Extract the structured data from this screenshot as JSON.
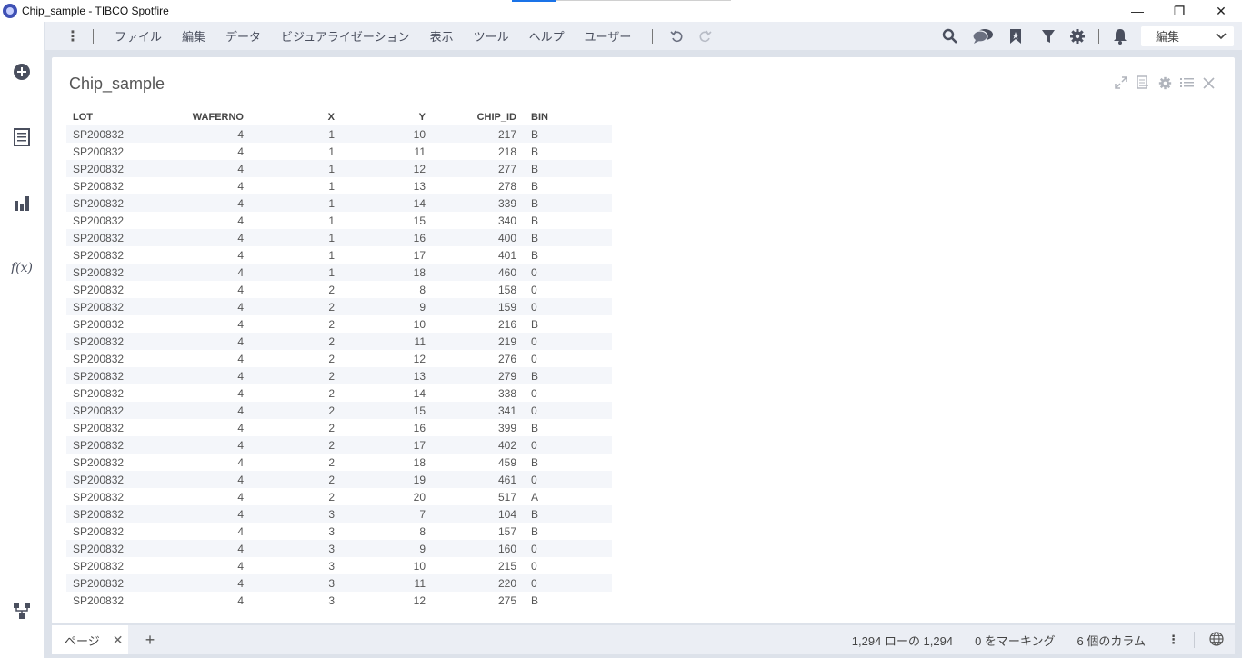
{
  "window": {
    "title": "Chip_sample - TIBCO Spotfire",
    "minimize": "—",
    "restore": "❐",
    "close": "✕"
  },
  "menu": {
    "items": [
      "ファイル",
      "編集",
      "データ",
      "ビジュアライゼーション",
      "表示",
      "ツール",
      "ヘルプ",
      "ユーザー"
    ],
    "mode": "編集"
  },
  "panel": {
    "title": "Chip_sample"
  },
  "table": {
    "columns": [
      "LOT",
      "WAFERNO",
      "X",
      "Y",
      "CHIP_ID",
      "BIN"
    ],
    "rows": [
      [
        "SP200832",
        "4",
        "1",
        "10",
        "217",
        "B"
      ],
      [
        "SP200832",
        "4",
        "1",
        "11",
        "218",
        "B"
      ],
      [
        "SP200832",
        "4",
        "1",
        "12",
        "277",
        "B"
      ],
      [
        "SP200832",
        "4",
        "1",
        "13",
        "278",
        "B"
      ],
      [
        "SP200832",
        "4",
        "1",
        "14",
        "339",
        "B"
      ],
      [
        "SP200832",
        "4",
        "1",
        "15",
        "340",
        "B"
      ],
      [
        "SP200832",
        "4",
        "1",
        "16",
        "400",
        "B"
      ],
      [
        "SP200832",
        "4",
        "1",
        "17",
        "401",
        "B"
      ],
      [
        "SP200832",
        "4",
        "1",
        "18",
        "460",
        "0"
      ],
      [
        "SP200832",
        "4",
        "2",
        "8",
        "158",
        "0"
      ],
      [
        "SP200832",
        "4",
        "2",
        "9",
        "159",
        "0"
      ],
      [
        "SP200832",
        "4",
        "2",
        "10",
        "216",
        "B"
      ],
      [
        "SP200832",
        "4",
        "2",
        "11",
        "219",
        "0"
      ],
      [
        "SP200832",
        "4",
        "2",
        "12",
        "276",
        "0"
      ],
      [
        "SP200832",
        "4",
        "2",
        "13",
        "279",
        "B"
      ],
      [
        "SP200832",
        "4",
        "2",
        "14",
        "338",
        "0"
      ],
      [
        "SP200832",
        "4",
        "2",
        "15",
        "341",
        "0"
      ],
      [
        "SP200832",
        "4",
        "2",
        "16",
        "399",
        "B"
      ],
      [
        "SP200832",
        "4",
        "2",
        "17",
        "402",
        "0"
      ],
      [
        "SP200832",
        "4",
        "2",
        "18",
        "459",
        "B"
      ],
      [
        "SP200832",
        "4",
        "2",
        "19",
        "461",
        "0"
      ],
      [
        "SP200832",
        "4",
        "2",
        "20",
        "517",
        "A"
      ],
      [
        "SP200832",
        "4",
        "3",
        "7",
        "104",
        "B"
      ],
      [
        "SP200832",
        "4",
        "3",
        "8",
        "157",
        "B"
      ],
      [
        "SP200832",
        "4",
        "3",
        "9",
        "160",
        "0"
      ],
      [
        "SP200832",
        "4",
        "3",
        "10",
        "215",
        "0"
      ],
      [
        "SP200832",
        "4",
        "3",
        "11",
        "220",
        "0"
      ],
      [
        "SP200832",
        "4",
        "3",
        "12",
        "275",
        "B"
      ]
    ]
  },
  "statusbar": {
    "page_tab": "ページ",
    "page_close": "✕",
    "add_page": "+",
    "row_count": "1,294 ローの 1,294",
    "marked": "0 をマーキング",
    "columns": "6 個のカラム"
  },
  "icons": {
    "sidebar": [
      "add-icon",
      "data-table-icon",
      "visualization-icon",
      "function-icon",
      "hierarchy-icon"
    ],
    "toolbar": [
      "undo-icon",
      "redo-icon",
      "search-icon",
      "comment-icon",
      "bookmark-icon",
      "filter-icon",
      "settings-icon",
      "notification-icon"
    ]
  },
  "colors": {
    "accent": "#1a73e8",
    "frame": "#dde2ea",
    "toolbar": "#ebeef4"
  }
}
